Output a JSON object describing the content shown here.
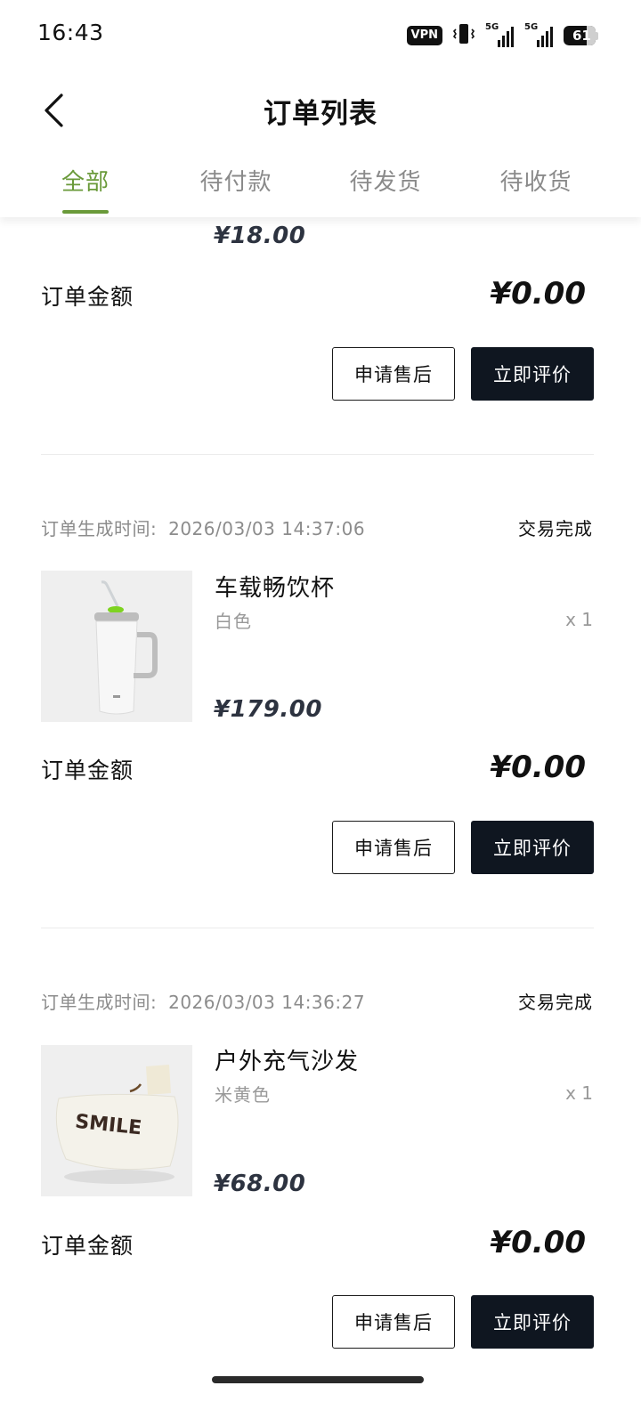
{
  "status_bar": {
    "time": "16:43",
    "vpn": "VPN",
    "net1": "5G",
    "net2": "5G",
    "battery": "61"
  },
  "header": {
    "title": "订单列表",
    "back_icon": "chevron-left-icon"
  },
  "tabs": [
    {
      "label": "全部",
      "active": true
    },
    {
      "label": "待付款",
      "active": false
    },
    {
      "label": "待发货",
      "active": false
    },
    {
      "label": "待收货",
      "active": false
    }
  ],
  "partial_order": {
    "price": "¥18.00",
    "amount_label": "订单金额",
    "amount": "¥0.00",
    "btn_after_sale": "申请售后",
    "btn_review": "立即评价"
  },
  "orders": [
    {
      "time_label": "订单生成时间:",
      "time": "2026/03/03 14:37:06",
      "status": "交易完成",
      "product_name": "车载畅饮杯",
      "spec": "白色",
      "qty": "x 1",
      "price": "¥179.00",
      "amount_label": "订单金额",
      "amount": "¥0.00",
      "btn_after_sale": "申请售后",
      "btn_review": "立即评价"
    },
    {
      "time_label": "订单生成时间:",
      "time": "2026/03/03 14:36:27",
      "status": "交易完成",
      "product_name": "户外充气沙发",
      "spec": "米黄色",
      "qty": "x 1",
      "price": "¥68.00",
      "amount_label": "订单金额",
      "amount": "¥0.00",
      "btn_after_sale": "申请售后",
      "btn_review": "立即评价",
      "image_text": "SMILE"
    }
  ],
  "colors": {
    "accent": "#6a9a3a",
    "dark_button": "#0f1620",
    "price": "#2d3340"
  }
}
